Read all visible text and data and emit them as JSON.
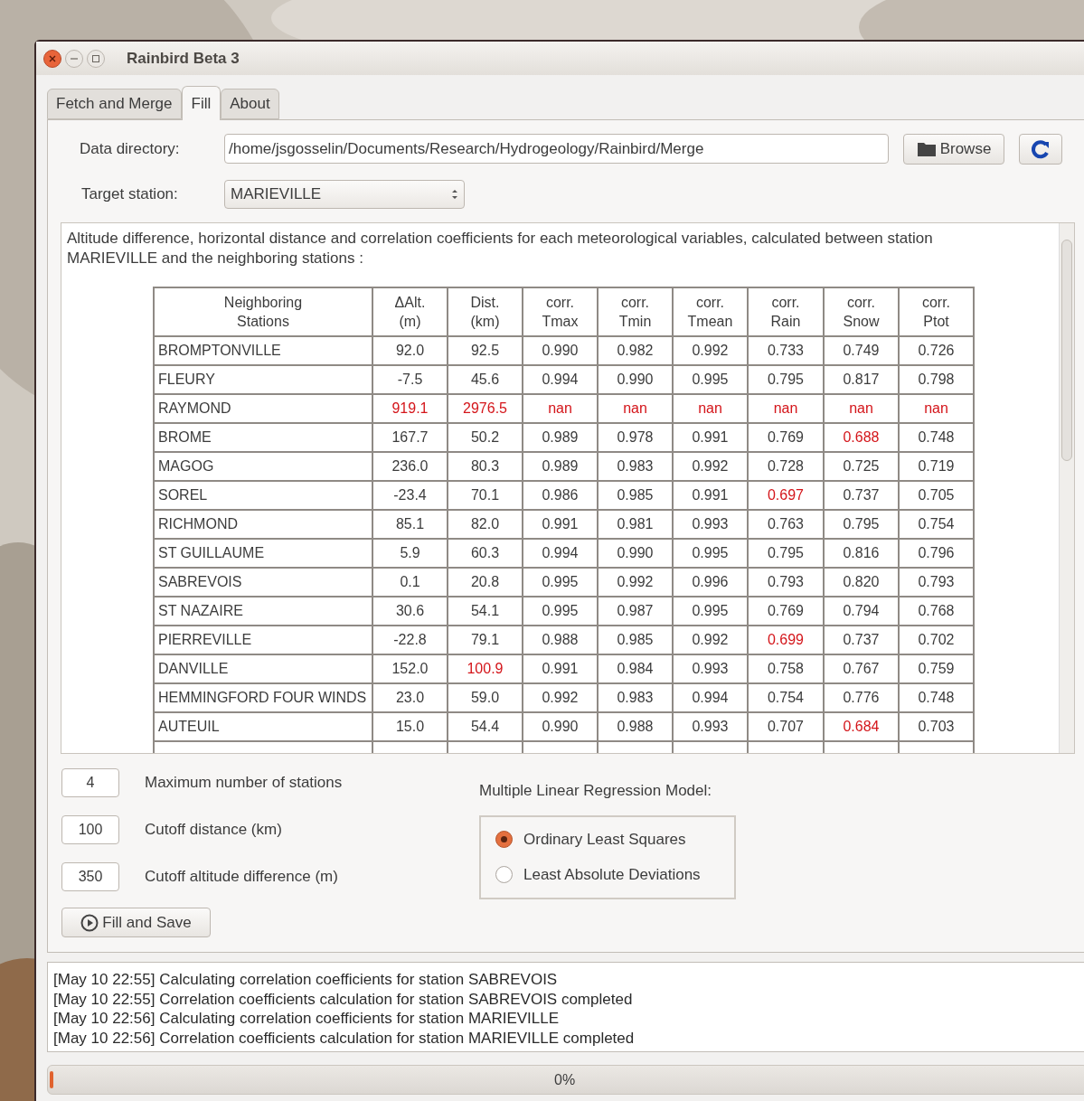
{
  "window": {
    "title": "Rainbird Beta 3"
  },
  "tabs": [
    {
      "label": "Fetch and Merge",
      "selected": false
    },
    {
      "label": "Fill",
      "selected": true
    },
    {
      "label": "About",
      "selected": false
    }
  ],
  "data_directory": {
    "label": "Data directory:",
    "value": "/home/jsgosselin/Documents/Research/Hydrogeology/Rainbird/Merge",
    "browse_button": "Browse"
  },
  "target_station": {
    "label": "Target station:",
    "value": "MARIEVILLE"
  },
  "description": "Altitude difference, horizontal distance and correlation coefficients for each meteorological variables, calculated between station MARIEVILLE and the neighboring stations :",
  "table": {
    "columns": [
      "Neighboring\nStations",
      "ΔAlt.\n(m)",
      "Dist.\n(km)",
      "corr.\nTmax",
      "corr.\nTmin",
      "corr.\nTmean",
      "corr.\nRain",
      "corr.\nSnow",
      "corr.\nPtot"
    ],
    "rows": [
      [
        {
          "text": "BROMPTONVILLE",
          "alert": false
        },
        {
          "text": "92.0",
          "alert": false
        },
        {
          "text": "92.5",
          "alert": false
        },
        {
          "text": "0.990",
          "alert": false
        },
        {
          "text": "0.982",
          "alert": false
        },
        {
          "text": "0.992",
          "alert": false
        },
        {
          "text": "0.733",
          "alert": false
        },
        {
          "text": "0.749",
          "alert": false
        },
        {
          "text": "0.726",
          "alert": false
        }
      ],
      [
        {
          "text": "FLEURY",
          "alert": false
        },
        {
          "text": "-7.5",
          "alert": false
        },
        {
          "text": "45.6",
          "alert": false
        },
        {
          "text": "0.994",
          "alert": false
        },
        {
          "text": "0.990",
          "alert": false
        },
        {
          "text": "0.995",
          "alert": false
        },
        {
          "text": "0.795",
          "alert": false
        },
        {
          "text": "0.817",
          "alert": false
        },
        {
          "text": "0.798",
          "alert": false
        }
      ],
      [
        {
          "text": "RAYMOND",
          "alert": false
        },
        {
          "text": "919.1",
          "alert": true
        },
        {
          "text": "2976.5",
          "alert": true
        },
        {
          "text": "nan",
          "alert": true
        },
        {
          "text": "nan",
          "alert": true
        },
        {
          "text": "nan",
          "alert": true
        },
        {
          "text": "nan",
          "alert": true
        },
        {
          "text": "nan",
          "alert": true
        },
        {
          "text": "nan",
          "alert": true
        }
      ],
      [
        {
          "text": "BROME",
          "alert": false
        },
        {
          "text": "167.7",
          "alert": false
        },
        {
          "text": "50.2",
          "alert": false
        },
        {
          "text": "0.989",
          "alert": false
        },
        {
          "text": "0.978",
          "alert": false
        },
        {
          "text": "0.991",
          "alert": false
        },
        {
          "text": "0.769",
          "alert": false
        },
        {
          "text": "0.688",
          "alert": true
        },
        {
          "text": "0.748",
          "alert": false
        }
      ],
      [
        {
          "text": "MAGOG",
          "alert": false
        },
        {
          "text": "236.0",
          "alert": false
        },
        {
          "text": "80.3",
          "alert": false
        },
        {
          "text": "0.989",
          "alert": false
        },
        {
          "text": "0.983",
          "alert": false
        },
        {
          "text": "0.992",
          "alert": false
        },
        {
          "text": "0.728",
          "alert": false
        },
        {
          "text": "0.725",
          "alert": false
        },
        {
          "text": "0.719",
          "alert": false
        }
      ],
      [
        {
          "text": "SOREL",
          "alert": false
        },
        {
          "text": "-23.4",
          "alert": false
        },
        {
          "text": "70.1",
          "alert": false
        },
        {
          "text": "0.986",
          "alert": false
        },
        {
          "text": "0.985",
          "alert": false
        },
        {
          "text": "0.991",
          "alert": false
        },
        {
          "text": "0.697",
          "alert": true
        },
        {
          "text": "0.737",
          "alert": false
        },
        {
          "text": "0.705",
          "alert": false
        }
      ],
      [
        {
          "text": "RICHMOND",
          "alert": false
        },
        {
          "text": "85.1",
          "alert": false
        },
        {
          "text": "82.0",
          "alert": false
        },
        {
          "text": "0.991",
          "alert": false
        },
        {
          "text": "0.981",
          "alert": false
        },
        {
          "text": "0.993",
          "alert": false
        },
        {
          "text": "0.763",
          "alert": false
        },
        {
          "text": "0.795",
          "alert": false
        },
        {
          "text": "0.754",
          "alert": false
        }
      ],
      [
        {
          "text": "ST GUILLAUME",
          "alert": false
        },
        {
          "text": "5.9",
          "alert": false
        },
        {
          "text": "60.3",
          "alert": false
        },
        {
          "text": "0.994",
          "alert": false
        },
        {
          "text": "0.990",
          "alert": false
        },
        {
          "text": "0.995",
          "alert": false
        },
        {
          "text": "0.795",
          "alert": false
        },
        {
          "text": "0.816",
          "alert": false
        },
        {
          "text": "0.796",
          "alert": false
        }
      ],
      [
        {
          "text": "SABREVOIS",
          "alert": false
        },
        {
          "text": "0.1",
          "alert": false
        },
        {
          "text": "20.8",
          "alert": false
        },
        {
          "text": "0.995",
          "alert": false
        },
        {
          "text": "0.992",
          "alert": false
        },
        {
          "text": "0.996",
          "alert": false
        },
        {
          "text": "0.793",
          "alert": false
        },
        {
          "text": "0.820",
          "alert": false
        },
        {
          "text": "0.793",
          "alert": false
        }
      ],
      [
        {
          "text": "ST NAZAIRE",
          "alert": false
        },
        {
          "text": "30.6",
          "alert": false
        },
        {
          "text": "54.1",
          "alert": false
        },
        {
          "text": "0.995",
          "alert": false
        },
        {
          "text": "0.987",
          "alert": false
        },
        {
          "text": "0.995",
          "alert": false
        },
        {
          "text": "0.769",
          "alert": false
        },
        {
          "text": "0.794",
          "alert": false
        },
        {
          "text": "0.768",
          "alert": false
        }
      ],
      [
        {
          "text": "PIERREVILLE",
          "alert": false
        },
        {
          "text": "-22.8",
          "alert": false
        },
        {
          "text": "79.1",
          "alert": false
        },
        {
          "text": "0.988",
          "alert": false
        },
        {
          "text": "0.985",
          "alert": false
        },
        {
          "text": "0.992",
          "alert": false
        },
        {
          "text": "0.699",
          "alert": true
        },
        {
          "text": "0.737",
          "alert": false
        },
        {
          "text": "0.702",
          "alert": false
        }
      ],
      [
        {
          "text": "DANVILLE",
          "alert": false
        },
        {
          "text": "152.0",
          "alert": false
        },
        {
          "text": "100.9",
          "alert": true
        },
        {
          "text": "0.991",
          "alert": false
        },
        {
          "text": "0.984",
          "alert": false
        },
        {
          "text": "0.993",
          "alert": false
        },
        {
          "text": "0.758",
          "alert": false
        },
        {
          "text": "0.767",
          "alert": false
        },
        {
          "text": "0.759",
          "alert": false
        }
      ],
      [
        {
          "text": "HEMMINGFORD FOUR WINDS",
          "alert": false
        },
        {
          "text": "23.0",
          "alert": false
        },
        {
          "text": "59.0",
          "alert": false
        },
        {
          "text": "0.992",
          "alert": false
        },
        {
          "text": "0.983",
          "alert": false
        },
        {
          "text": "0.994",
          "alert": false
        },
        {
          "text": "0.754",
          "alert": false
        },
        {
          "text": "0.776",
          "alert": false
        },
        {
          "text": "0.748",
          "alert": false
        }
      ],
      [
        {
          "text": "AUTEUIL",
          "alert": false
        },
        {
          "text": "15.0",
          "alert": false
        },
        {
          "text": "54.4",
          "alert": false
        },
        {
          "text": "0.990",
          "alert": false
        },
        {
          "text": "0.988",
          "alert": false
        },
        {
          "text": "0.993",
          "alert": false
        },
        {
          "text": "0.707",
          "alert": false
        },
        {
          "text": "0.684",
          "alert": true
        },
        {
          "text": "0.703",
          "alert": false
        }
      ]
    ]
  },
  "settings": [
    {
      "value": "4",
      "label": "Maximum number of stations"
    },
    {
      "value": "100",
      "label": "Cutoff distance (km)"
    },
    {
      "value": "350",
      "label": "Cutoff altitude difference (m)"
    }
  ],
  "fill_button": "Fill and Save",
  "regression": {
    "title": "Multiple Linear Regression Model:",
    "options": [
      {
        "label": "Ordinary Least Squares",
        "selected": true
      },
      {
        "label": "Least Absolute Deviations",
        "selected": false
      }
    ]
  },
  "log": [
    "[May 10 22:55] Calculating correlation coefficients for station SABREVOIS",
    "[May 10 22:55] Correlation coefficients calculation for station SABREVOIS completed",
    "[May 10 22:56] Calculating correlation coefficients for station MARIEVILLE",
    "[May 10 22:56] Correlation coefficients calculation for station MARIEVILLE completed"
  ],
  "progress": {
    "level": 0.0,
    "reading": "0%"
  }
}
